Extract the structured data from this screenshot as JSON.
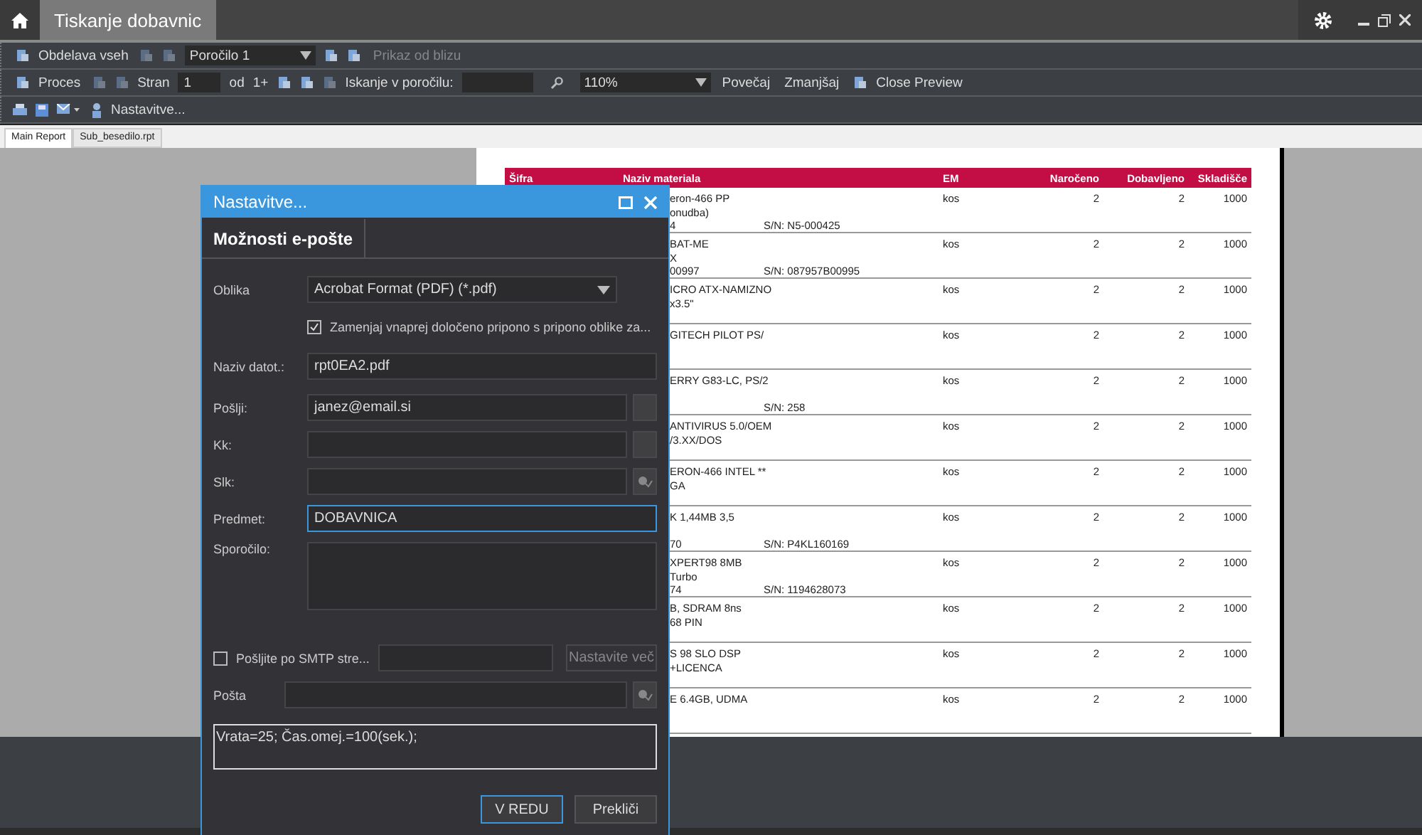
{
  "title_bar": {
    "tabs": [
      {
        "label": "Tiskanje dobavnic",
        "selected": true
      }
    ]
  },
  "toolbar_rows": [
    [
      {
        "kind": "icon_button",
        "label": "Obdelava vseh",
        "disabled": false
      },
      {
        "kind": "icon",
        "disabled": true
      },
      {
        "kind": "icon",
        "disabled": true
      },
      {
        "kind": "dropdown",
        "value": "Poročilo 1"
      },
      {
        "kind": "icon",
        "disabled": false
      },
      {
        "kind": "icon",
        "disabled": false
      },
      {
        "kind": "text_button",
        "label": "Prikaz od blizu",
        "disabled": true
      }
    ],
    [
      {
        "kind": "icon_button",
        "label": "Proces",
        "disabled": false
      },
      {
        "kind": "icon",
        "disabled": true
      },
      {
        "kind": "icon",
        "disabled": true
      },
      {
        "kind": "label",
        "label": "Stran"
      },
      {
        "kind": "field",
        "value": "1"
      },
      {
        "kind": "label",
        "label": "od"
      },
      {
        "kind": "label",
        "label": "1+"
      },
      {
        "kind": "icon",
        "disabled": false
      },
      {
        "kind": "icon",
        "disabled": false
      },
      {
        "kind": "icon",
        "disabled": true
      },
      {
        "kind": "label",
        "label": "Iskanje v poročilu:"
      },
      {
        "kind": "search_field"
      },
      {
        "kind": "search"
      },
      {
        "kind": "dropdown",
        "value": "110%"
      },
      {
        "kind": "text_button",
        "label": "Povečaj",
        "disabled": false
      },
      {
        "kind": "text_button",
        "label": "Zmanjšaj",
        "disabled": false
      },
      {
        "kind": "icon_button",
        "label": "Close Preview",
        "disabled": false
      }
    ]
  ],
  "settings_button": {
    "label": "Nastavitve..."
  },
  "report_tabs": [
    {
      "label": "Main Report",
      "selected": true
    },
    {
      "label": "Sub_besedilo.rpt",
      "selected": false
    }
  ],
  "report": {
    "columns": [
      "Šifra",
      "Naziv materiala",
      "EM",
      "Naročeno",
      "Dobavljeno",
      "Skladišče"
    ],
    "rows": [
      {
        "lines": [
          "eron-466 PP",
          "onudba)"
        ],
        "code": "4",
        "serial": "S/N: N5-000425",
        "unit": "kos",
        "ordered": "2",
        "delivered": "2",
        "stock": "1000"
      },
      {
        "lines": [
          "BAT-ME",
          "X"
        ],
        "code": "00997",
        "serial": "S/N: 087957B00995",
        "unit": "kos",
        "ordered": "2",
        "delivered": "2",
        "stock": "1000"
      },
      {
        "lines": [
          "ICRO ATX-NAMIZNO",
          "x3.5\""
        ],
        "unit": "kos",
        "ordered": "2",
        "delivered": "2",
        "stock": "1000"
      },
      {
        "lines": [
          "GITECH PILOT PS/"
        ],
        "unit": "kos",
        "ordered": "2",
        "delivered": "2",
        "stock": "1000"
      },
      {
        "lines": [
          "ERRY G83-LC, PS/2"
        ],
        "serial": "S/N: 258",
        "unit": "kos",
        "ordered": "2",
        "delivered": "2",
        "stock": "1000"
      },
      {
        "lines": [
          "ANTIVIRUS 5.0/OEM",
          "/3.XX/DOS"
        ],
        "unit": "kos",
        "ordered": "2",
        "delivered": "2",
        "stock": "1000"
      },
      {
        "lines": [
          "ERON-466 INTEL **",
          "GA"
        ],
        "unit": "kos",
        "ordered": "2",
        "delivered": "2",
        "stock": "1000"
      },
      {
        "lines": [
          "K 1,44MB 3,5"
        ],
        "code": "70",
        "serial": "S/N: P4KL160169",
        "unit": "kos",
        "ordered": "2",
        "delivered": "2",
        "stock": "1000"
      },
      {
        "lines": [
          "XPERT98 8MB",
          "Turbo"
        ],
        "code": "74",
        "serial": "S/N: 1194628073",
        "unit": "kos",
        "ordered": "2",
        "delivered": "2",
        "stock": "1000"
      },
      {
        "lines": [
          "B, SDRAM 8ns",
          "68 PIN"
        ],
        "unit": "kos",
        "ordered": "2",
        "delivered": "2",
        "stock": "1000"
      },
      {
        "lines": [
          "S 98 SLO DSP",
          "+LICENCA"
        ],
        "unit": "kos",
        "ordered": "2",
        "delivered": "2",
        "stock": "1000"
      },
      {
        "lines": [
          "E 6.4GB, UDMA"
        ],
        "unit": "kos",
        "ordered": "2",
        "delivered": "2",
        "stock": "1000"
      }
    ]
  },
  "dialog": {
    "title": "Nastavitve...",
    "tabs": [
      {
        "label": "Možnosti e-pošte",
        "selected": true
      }
    ],
    "format": {
      "label": "Oblika",
      "value": "Acrobat Format (PDF) (*.pdf)"
    },
    "replace_extension": {
      "label": "Zamenjaj vnaprej določeno pripono s pripono oblike za...",
      "checked": true
    },
    "file_name": {
      "label": "Naziv datot.:",
      "value": "rpt0EA2.pdf"
    },
    "to": {
      "label": "Pošlji:",
      "value": "janez@email.si"
    },
    "cc": {
      "label": "Kk:"
    },
    "bcc": {
      "label": "Slk:"
    },
    "subject": {
      "label": "Predmet:",
      "value": "DOBAVNICA",
      "focused": true
    },
    "message": {
      "label": "Sporočilo:"
    },
    "smtp": {
      "label": "Pošljite po SMTP stre...",
      "checked": false,
      "button": "Nastavite več"
    },
    "mail": {
      "label": "Pošta"
    },
    "log": "Vrata=25; Čas.omej.=100(sek.);",
    "buttons": [
      {
        "label": "V REDU",
        "default": true
      },
      {
        "label": "Prekliči",
        "default": false
      }
    ]
  }
}
